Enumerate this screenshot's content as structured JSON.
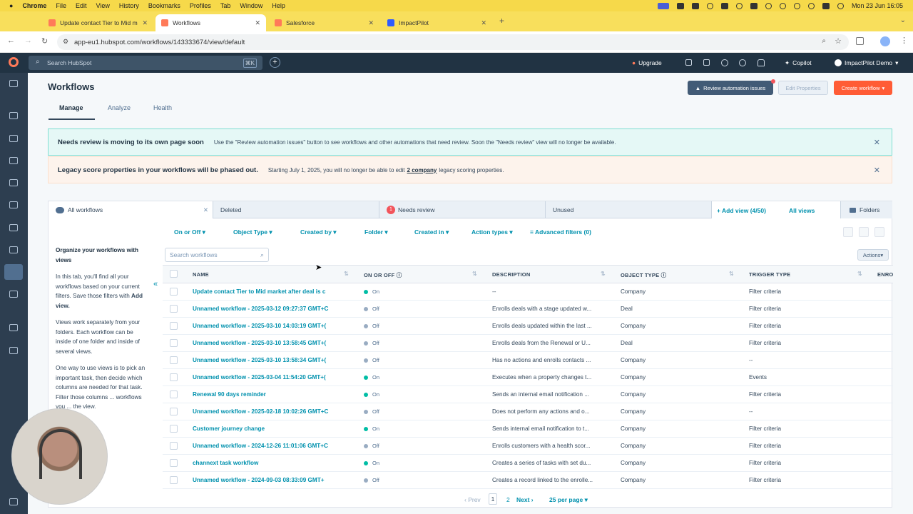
{
  "mac_menu": {
    "apple": "",
    "app": "Chrome",
    "items": [
      "File",
      "Edit",
      "View",
      "History",
      "Bookmarks",
      "Profiles",
      "Tab",
      "Window",
      "Help"
    ],
    "datetime": "Mon 23 Jun 16:05"
  },
  "browser_tabs": [
    {
      "title": "Update contact Tier to Mid m",
      "favicon_color": "#ff7a59"
    },
    {
      "title": "Workflows",
      "favicon_color": "#ff7a59"
    },
    {
      "title": "Salesforce",
      "favicon_color": "#ff7a59"
    },
    {
      "title": "ImpactPilot",
      "favicon_color": "#2e5bff"
    }
  ],
  "new_tab": "+",
  "address": {
    "url": "app-eu1.hubspot.com/workflows/143333674/view/default"
  },
  "hubspot_nav": {
    "search_placeholder": "Search HubSpot",
    "shortcut": "⌘K",
    "add": "+",
    "upgrade": "Upgrade",
    "copilot": "Copilot",
    "account": "ImpactPilot Demo"
  },
  "header": {
    "title": "Workflows",
    "tabs": [
      "Manage",
      "Analyze",
      "Health"
    ],
    "review_btn": "Review automation issues",
    "edit_props_btn": "Edit Properties",
    "create_btn": "Create workflow"
  },
  "banners": [
    {
      "title": "Needs review is moving to its own page soon",
      "text": "Use the \"Review automation issues\" button to see workflows and other automations that need review. Soon the \"Needs review\" view will no longer be available."
    },
    {
      "title": "Legacy score properties in your workflows will be phased out.",
      "text_before": "Starting July 1, 2025, you will no longer be able to edit",
      "link": "2 company",
      "text_after": "legacy scoring properties."
    }
  ],
  "views": {
    "tabs": [
      "All workflows",
      "Deleted",
      "Needs review",
      "Unused"
    ],
    "needs_review_count": "1",
    "add_view": "Add view (4/50)",
    "all_views": "All views",
    "folders": "Folders"
  },
  "filters": [
    "On or Off",
    "Object Type",
    "Created by",
    "Folder",
    "Created in",
    "Action types"
  ],
  "advanced_filters": "Advanced filters (0)",
  "search_placeholder": "Search workflows",
  "actions": "Actions",
  "left_panel": {
    "title": "Organize your workflows with views",
    "p1_before": "In this tab, you'll find all your workflows based on your current filters. Save those filters with",
    "p1_link": "Add view.",
    "p2": "Views work separately from your folders. Each workflow can be inside of one folder and inside of several views.",
    "p3": "One way to use views is to pick an important task, then decide which columns are needed for that task. Filter those columns ... workflows you ... the view."
  },
  "columns": [
    "NAME",
    "ON OR OFF",
    "DESCRIPTION",
    "OBJECT TYPE",
    "TRIGGER TYPE",
    "ENRO"
  ],
  "rows": [
    {
      "name": "Update contact Tier to Mid market after deal is c",
      "status": "On",
      "desc": "--",
      "object": "Company",
      "trigger": "Filter criteria"
    },
    {
      "name": "Unnamed workflow - 2025-03-12 09:27:37 GMT+C",
      "status": "Off",
      "desc": "Enrolls deals with a stage updated w...",
      "object": "Deal",
      "trigger": "Filter criteria"
    },
    {
      "name": "Unnamed workflow - 2025-03-10 14:03:19 GMT+(",
      "status": "Off",
      "desc": "Enrolls deals updated within the last ...",
      "object": "Company",
      "trigger": "Filter criteria"
    },
    {
      "name": "Unnamed workflow - 2025-03-10 13:58:45 GMT+(",
      "status": "Off",
      "desc": "Enrolls deals from the Renewal or U...",
      "object": "Deal",
      "trigger": "Filter criteria"
    },
    {
      "name": "Unnamed workflow - 2025-03-10 13:58:34 GMT+(",
      "status": "Off",
      "desc": "Has no actions and enrolls contacts ...",
      "object": "Company",
      "trigger": "--"
    },
    {
      "name": "Unnamed workflow - 2025-03-04 11:54:20 GMT+(",
      "status": "On",
      "desc": "Executes when a property changes t...",
      "object": "Company",
      "trigger": "Events"
    },
    {
      "name": "Renewal 90 days reminder",
      "status": "On",
      "desc": "Sends an internal email notification ...",
      "object": "Company",
      "trigger": "Filter criteria"
    },
    {
      "name": "Unnamed workflow - 2025-02-18 10:02:26 GMT+C",
      "status": "Off",
      "desc": "Does not perform any actions and o...",
      "object": "Company",
      "trigger": "--"
    },
    {
      "name": "Customer journey change",
      "status": "On",
      "desc": "Sends internal email notification to t...",
      "object": "Company",
      "trigger": "Filter criteria"
    },
    {
      "name": "Unnamed workflow - 2024-12-26 11:01:06 GMT+C",
      "status": "Off",
      "desc": "Enrolls customers with a health scor...",
      "object": "Company",
      "trigger": "Filter criteria"
    },
    {
      "name": "channext task workflow",
      "status": "On",
      "desc": "Creates a series of tasks with set du...",
      "object": "Company",
      "trigger": "Filter criteria"
    },
    {
      "name": "Unnamed workflow - 2024-09-03 08:33:09 GMT+",
      "status": "Off",
      "desc": "Creates a record linked to the enrolle...",
      "object": "Company",
      "trigger": "Filter criteria"
    }
  ],
  "pagination": {
    "prev": "Prev",
    "pages": [
      "1",
      "2"
    ],
    "next": "Next",
    "per_page": "25 per page"
  },
  "colors": {
    "on": "#00bda5",
    "off": "#99acc2",
    "link": "#0091ae",
    "orange": "#ff5c35",
    "navy": "#213343"
  }
}
